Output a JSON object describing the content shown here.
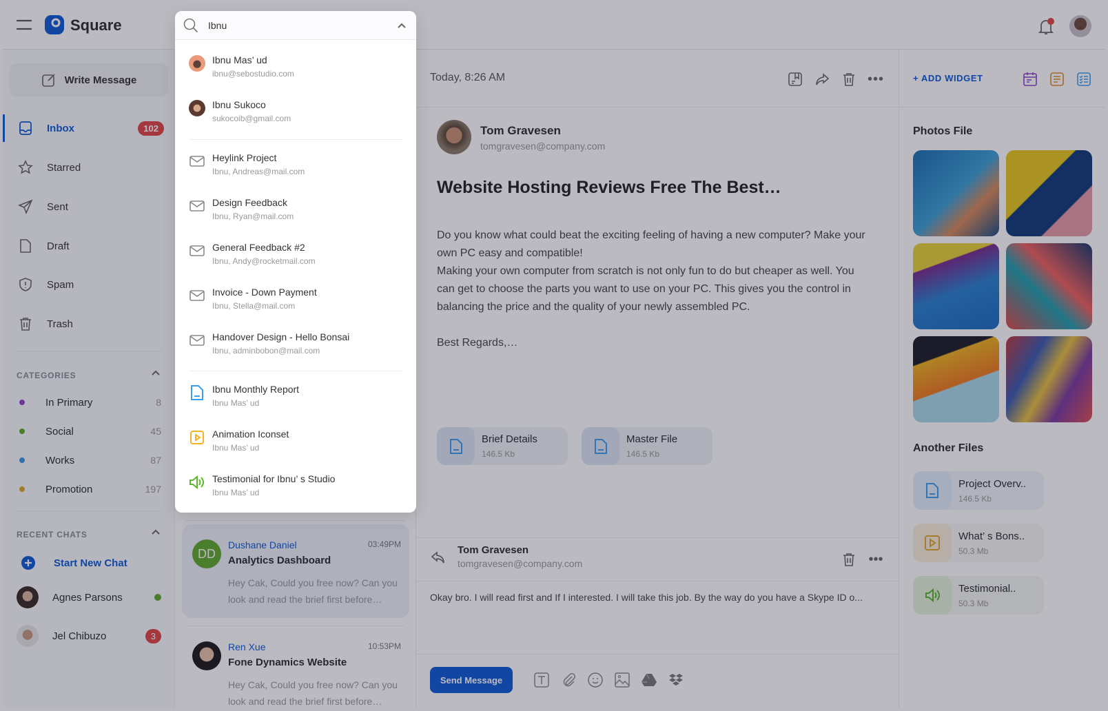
{
  "app": {
    "name": "Square"
  },
  "search": {
    "value": "Ibnu"
  },
  "dropdown": {
    "contacts": [
      {
        "name": "Ibnu Mas’ ud",
        "email": "ibnu@sebostudio.com"
      },
      {
        "name": "Ibnu Sukoco",
        "email": "sukocoib@gmail.com"
      }
    ],
    "messages": [
      {
        "title": "Heylink Project",
        "sub": "Ibnu, Andreas@mail.com"
      },
      {
        "title": "Design Feedback",
        "sub": "Ibnu, Ryan@mail.com"
      },
      {
        "title": "General Feedback #2",
        "sub": "Ibnu, Andy@rocketmail.com"
      },
      {
        "title": "Invoice - Down Payment",
        "sub": "Ibnu, Stella@mail.com"
      },
      {
        "title": "Handover Design - Hello Bonsai",
        "sub": "Ibnu, adminbobon@mail.com"
      }
    ],
    "files": [
      {
        "title": "Ibnu Monthly Report",
        "sub": "Ibnu Mas’ ud",
        "icon": "document-icon",
        "color": "#3b9cf0"
      },
      {
        "title": "Animation Iconset",
        "sub": "Ibnu Mas’ ud",
        "icon": "play-icon",
        "color": "#f5b324"
      },
      {
        "title": "Testimonial for Ibnu’ s Studio",
        "sub": "Ibnu Mas’ ud",
        "icon": "speaker-icon",
        "color": "#5cb52e"
      }
    ]
  },
  "sidebar": {
    "write": "Write Message",
    "nav": [
      {
        "label": "Inbox",
        "badge": "102",
        "active": true
      },
      {
        "label": "Starred"
      },
      {
        "label": "Sent"
      },
      {
        "label": "Draft"
      },
      {
        "label": "Spam"
      },
      {
        "label": "Trash"
      }
    ],
    "categories_title": "CATEGORIES",
    "categories": [
      {
        "label": "In Primary",
        "count": "8",
        "color": "#8e44c9"
      },
      {
        "label": "Social",
        "count": "45",
        "color": "#5fa82c"
      },
      {
        "label": "Works",
        "count": "87",
        "color": "#3a95dc"
      },
      {
        "label": "Promotion",
        "count": "197",
        "color": "#e0a82a"
      }
    ],
    "recent_title": "RECENT CHATS",
    "start_chat": "Start New Chat",
    "chats": [
      {
        "name": "Agnes Parsons",
        "status": "online"
      },
      {
        "name": "Jel Chibuzo",
        "badge": "3"
      }
    ]
  },
  "list": [
    {
      "initials": "DD",
      "name": "Dushane Daniel",
      "time": "03:49PM",
      "subject": "Analytics Dashboard",
      "preview": "Hey Cak, Could you free now? Can you look and read the brief first before…"
    },
    {
      "name": "Ren Xue",
      "time": "10:53PM",
      "subject": "Fone Dynamics Website",
      "preview": "Hey Cak, Could you free now? Can you look and read the brief first before…"
    }
  ],
  "email": {
    "date": "Today, 8:26 AM",
    "sender": "Tom Gravesen",
    "sender_email": "tomgravesen@company.com",
    "subject": "Website Hosting Reviews Free The Best…",
    "paragraphs": [
      "Do you know what could beat the exciting feeling of having a new computer? Make your own PC easy and compatible!",
      "Making your own computer from scratch is not only fun to do but cheaper as well. You can get to choose the parts you want to use on your PC. This gives you the control in balancing the price and the quality of your newly assembled PC.",
      "Best Regards,…"
    ],
    "attachments": [
      {
        "name": "Brief Details",
        "size": "146.5 Kb"
      },
      {
        "name": "Master File",
        "size": "146.5 Kb"
      }
    ]
  },
  "reply": {
    "sender": "Tom Gravesen",
    "email": "tomgravesen@company.com",
    "text": "Okay bro. I will read first and If I interested. I will take this job. By the way do you have a Skype ID o...",
    "send": "Send Message"
  },
  "right": {
    "add_widget": "+ ADD WIDGET",
    "photos_title": "Photos File",
    "files_title": "Another Files",
    "files": [
      {
        "name": "Project Overv..",
        "size": "146.5 Kb",
        "color": "#3b9cf0",
        "bg": "#e3eefb"
      },
      {
        "name": "What’ s Bons..",
        "size": "50.3 Mb",
        "color": "#e0a82a",
        "bg": "#fbf0dc"
      },
      {
        "name": "Testimonial..",
        "size": "50.3 Mb",
        "color": "#5cb52e",
        "bg": "#e6f3dd"
      }
    ]
  },
  "colors": {
    "accent": "#0d5ad6",
    "danger": "#e04545"
  }
}
